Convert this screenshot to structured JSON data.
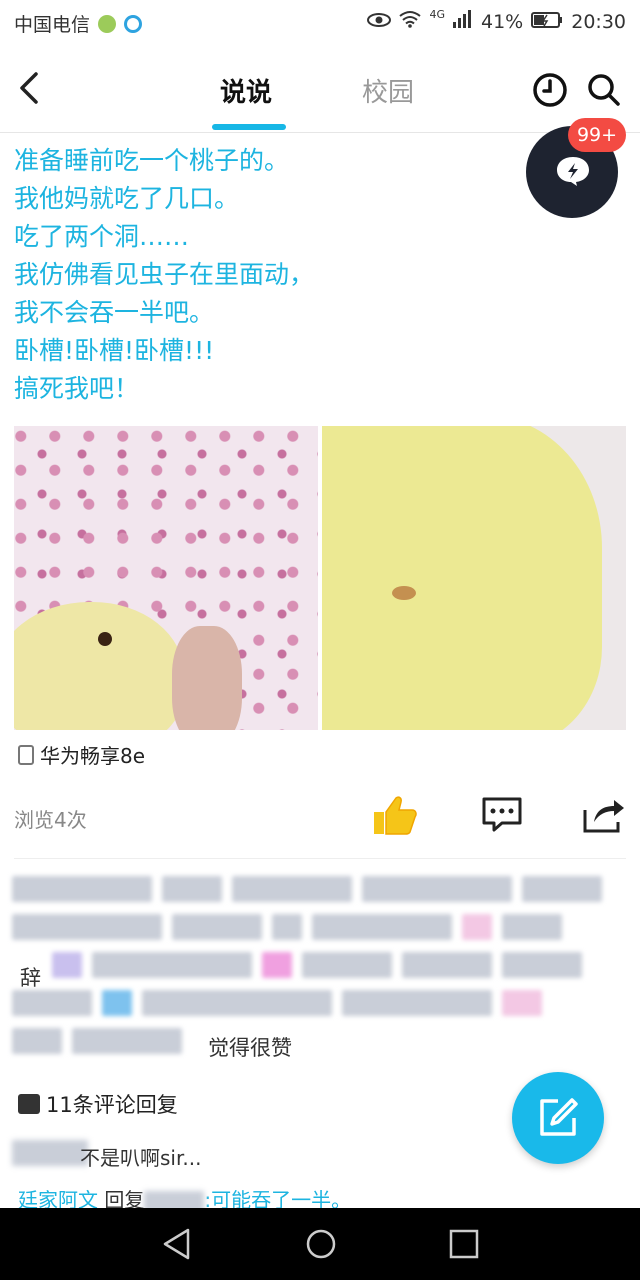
{
  "status_bar": {
    "carrier": "中国电信",
    "network": "4G",
    "battery": "41%",
    "time": "20:30"
  },
  "header": {
    "tabs": [
      {
        "label": "说说",
        "active": true
      },
      {
        "label": "校园",
        "active": false
      }
    ],
    "notification_badge": "99+"
  },
  "post": {
    "lines": [
      "准备睡前吃一个桃子的。",
      "我他妈就吃了几口。",
      "吃了两个洞……",
      "我仿佛看见虫子在里面动，",
      "我不会吞一半吧。",
      "卧槽!卧槽!卧槽!!!",
      "搞死我吧！"
    ],
    "device": "华为畅享8e",
    "views": "浏览4次"
  },
  "likes_area": {
    "visible_fragments": [
      "辞",
      "觉得很赞"
    ]
  },
  "comments": {
    "header": "11条评论回复",
    "items": [
      {
        "text": "不是叭啊sir..."
      },
      {
        "author": "廷家阿文",
        "reply_prefix": "回复",
        "text": ":可能吞了一半。"
      }
    ]
  },
  "colors": {
    "accent": "#1db4e0",
    "badge": "#f34b43",
    "dark_fab": "#1e2330"
  }
}
